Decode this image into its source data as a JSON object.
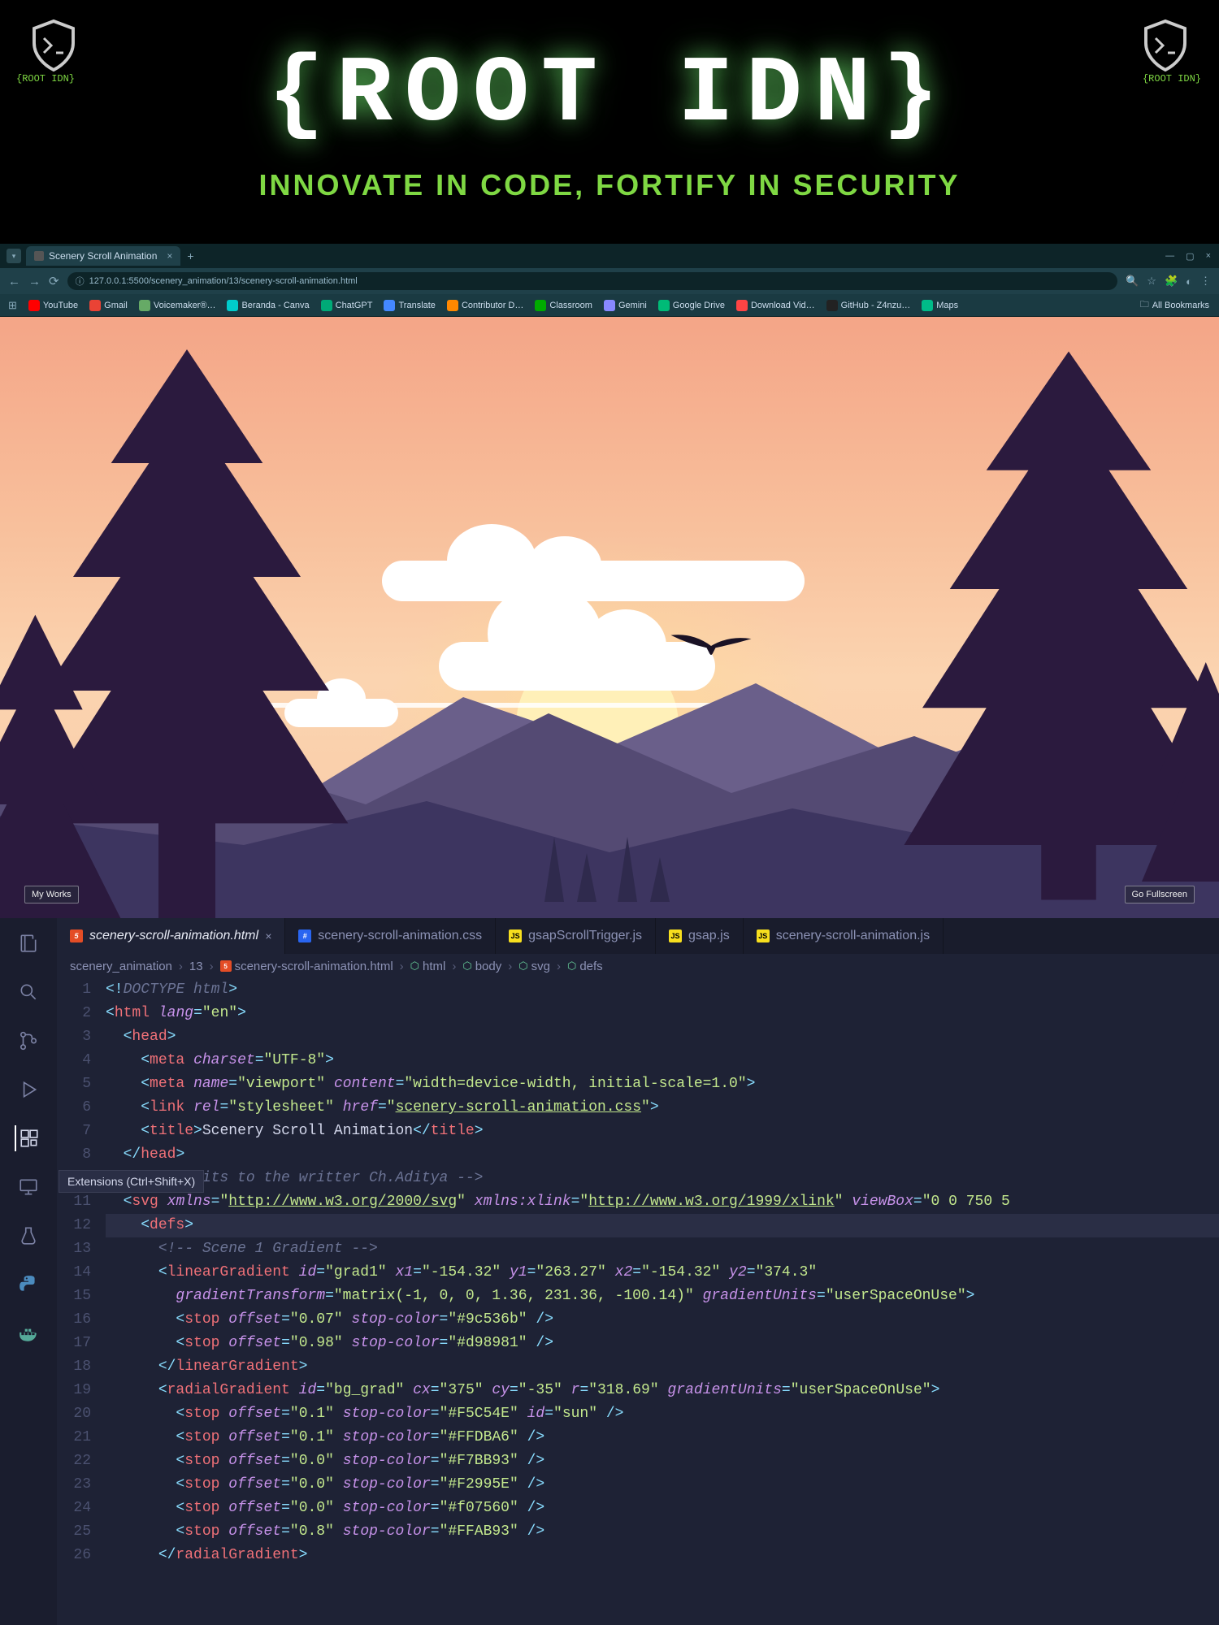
{
  "banner": {
    "title": "{ROOT IDN}",
    "subtitle": "INNOVATE IN CODE, FORTIFY IN SECURITY",
    "logo_label": "{ROOT IDN}"
  },
  "browser": {
    "tab_title": "Scenery Scroll Animation",
    "url": "127.0.0.1:5500/scenery_animation/13/scenery-scroll-animation.html",
    "bookmarks": [
      "YouTube",
      "Gmail",
      "Voicemaker®…",
      "Beranda - Canva",
      "ChatGPT",
      "Translate",
      "Contributor D…",
      "Classroom",
      "Gemini",
      "Google Drive",
      "Download Vid…",
      "GitHub - Z4nzu…",
      "Maps"
    ],
    "all_bookmarks": "All Bookmarks"
  },
  "scenery": {
    "btn_left": "My Works",
    "btn_right": "Go Fullscreen"
  },
  "editor": {
    "tooltip": "Extensions (Ctrl+Shift+X)",
    "tabs": [
      {
        "name": "scenery-scroll-animation.html",
        "type": "html",
        "active": true
      },
      {
        "name": "scenery-scroll-animation.css",
        "type": "css",
        "active": false
      },
      {
        "name": "gsapScrollTrigger.js",
        "type": "js",
        "active": false
      },
      {
        "name": "gsap.js",
        "type": "js",
        "active": false
      },
      {
        "name": "scenery-scroll-animation.js",
        "type": "js",
        "active": false
      }
    ],
    "breadcrumb": [
      "scenery_animation",
      "13",
      "scenery-scroll-animation.html",
      "html",
      "body",
      "svg",
      "defs"
    ],
    "lines": [
      {
        "n": 1,
        "html": "<span class='c-bracket'>&lt;!</span><span class='c-doctype'>DOCTYPE html</span><span class='c-bracket'>&gt;</span>"
      },
      {
        "n": 2,
        "html": "<span class='c-bracket'>&lt;</span><span class='c-tag'>html</span> <span class='c-attr'>lang</span><span class='c-bracket'>=</span><span class='c-string'>\"en\"</span><span class='c-bracket'>&gt;</span>"
      },
      {
        "n": 3,
        "html": "  <span class='c-bracket'>&lt;</span><span class='c-tag'>head</span><span class='c-bracket'>&gt;</span>"
      },
      {
        "n": 4,
        "html": "    <span class='c-bracket'>&lt;</span><span class='c-tag'>meta</span> <span class='c-attr'>charset</span><span class='c-bracket'>=</span><span class='c-string'>\"UTF-8\"</span><span class='c-bracket'>&gt;</span>"
      },
      {
        "n": 5,
        "html": "    <span class='c-bracket'>&lt;</span><span class='c-tag'>meta</span> <span class='c-attr'>name</span><span class='c-bracket'>=</span><span class='c-string'>\"viewport\"</span> <span class='c-attr'>content</span><span class='c-bracket'>=</span><span class='c-string'>\"width=device-width, initial-scale=1.0\"</span><span class='c-bracket'>&gt;</span>"
      },
      {
        "n": 6,
        "html": "    <span class='c-bracket'>&lt;</span><span class='c-tag'>link</span> <span class='c-attr'>rel</span><span class='c-bracket'>=</span><span class='c-string'>\"stylesheet\"</span> <span class='c-attr'>href</span><span class='c-bracket'>=</span><span class='c-string'>\"</span><span class='c-link'>scenery-scroll-animation.css</span><span class='c-string'>\"</span><span class='c-bracket'>&gt;</span>"
      },
      {
        "n": 7,
        "html": "    <span class='c-bracket'>&lt;</span><span class='c-tag'>title</span><span class='c-bracket'>&gt;</span><span class='c-text'>Scenery Scroll Animation</span><span class='c-bracket'>&lt;/</span><span class='c-tag'>title</span><span class='c-bracket'>&gt;</span>"
      },
      {
        "n": 8,
        "html": "  <span class='c-bracket'>&lt;/</span><span class='c-tag'>head</span><span class='c-bracket'>&gt;</span>"
      },
      {
        "n": 10,
        "html": "  <span class='c-comment'>&lt;!-- credits to the writter Ch.Aditya --&gt;</span>"
      },
      {
        "n": 11,
        "html": "  <span class='c-bracket'>&lt;</span><span class='c-tag'>svg</span> <span class='c-attr'>xmlns</span><span class='c-bracket'>=</span><span class='c-string'>\"</span><span class='c-link'>http://www.w3.org/2000/svg</span><span class='c-string'>\"</span> <span class='c-attr'>xmlns:xlink</span><span class='c-bracket'>=</span><span class='c-string'>\"</span><span class='c-link'>http://www.w3.org/1999/xlink</span><span class='c-string'>\"</span> <span class='c-attr'>viewBox</span><span class='c-bracket'>=</span><span class='c-string'>\"0 0 750 5</span>"
      },
      {
        "n": 12,
        "html": "    <span class='c-bracket'>&lt;</span><span class='c-tag'>defs</span><span class='c-bracket'>&gt;</span>",
        "hl": true
      },
      {
        "n": 13,
        "html": "      <span class='c-comment'>&lt;!-- Scene 1 Gradient --&gt;</span>"
      },
      {
        "n": 14,
        "html": "      <span class='c-bracket'>&lt;</span><span class='c-tag'>linearGradient</span> <span class='c-attr'>id</span><span class='c-bracket'>=</span><span class='c-string'>\"grad1\"</span> <span class='c-attr'>x1</span><span class='c-bracket'>=</span><span class='c-string'>\"-154.32\"</span> <span class='c-attr'>y1</span><span class='c-bracket'>=</span><span class='c-string'>\"263.27\"</span> <span class='c-attr'>x2</span><span class='c-bracket'>=</span><span class='c-string'>\"-154.32\"</span> <span class='c-attr'>y2</span><span class='c-bracket'>=</span><span class='c-string'>\"374.3\"</span>"
      },
      {
        "n": 15,
        "html": "        <span class='c-attr'>gradientTransform</span><span class='c-bracket'>=</span><span class='c-string'>\"matrix(-1, 0, 0, 1.36, 231.36, -100.14)\"</span> <span class='c-attr'>gradientUnits</span><span class='c-bracket'>=</span><span class='c-string'>\"userSpaceOnUse\"</span><span class='c-bracket'>&gt;</span>"
      },
      {
        "n": 16,
        "html": "        <span class='c-bracket'>&lt;</span><span class='c-tag'>stop</span> <span class='c-attr'>offset</span><span class='c-bracket'>=</span><span class='c-string'>\"0.07\"</span> <span class='c-attr'>stop-color</span><span class='c-bracket'>=</span><span class='c-string'>\"#9c536b\"</span> <span class='c-bracket'>/&gt;</span>"
      },
      {
        "n": 17,
        "html": "        <span class='c-bracket'>&lt;</span><span class='c-tag'>stop</span> <span class='c-attr'>offset</span><span class='c-bracket'>=</span><span class='c-string'>\"0.98\"</span> <span class='c-attr'>stop-color</span><span class='c-bracket'>=</span><span class='c-string'>\"#d98981\"</span> <span class='c-bracket'>/&gt;</span>"
      },
      {
        "n": 18,
        "html": "      <span class='c-bracket'>&lt;/</span><span class='c-tag'>linearGradient</span><span class='c-bracket'>&gt;</span>"
      },
      {
        "n": 19,
        "html": "      <span class='c-bracket'>&lt;</span><span class='c-tag'>radialGradient</span> <span class='c-attr'>id</span><span class='c-bracket'>=</span><span class='c-string'>\"bg_grad\"</span> <span class='c-attr'>cx</span><span class='c-bracket'>=</span><span class='c-string'>\"375\"</span> <span class='c-attr'>cy</span><span class='c-bracket'>=</span><span class='c-string'>\"-35\"</span> <span class='c-attr'>r</span><span class='c-bracket'>=</span><span class='c-string'>\"318.69\"</span> <span class='c-attr'>gradientUnits</span><span class='c-bracket'>=</span><span class='c-string'>\"userSpaceOnUse\"</span><span class='c-bracket'>&gt;</span>"
      },
      {
        "n": 20,
        "html": "        <span class='c-bracket'>&lt;</span><span class='c-tag'>stop</span> <span class='c-attr'>offset</span><span class='c-bracket'>=</span><span class='c-string'>\"0.1\"</span> <span class='c-attr'>stop-color</span><span class='c-bracket'>=</span><span class='c-string'>\"#F5C54E\"</span> <span class='c-attr'>id</span><span class='c-bracket'>=</span><span class='c-string'>\"sun\"</span> <span class='c-bracket'>/&gt;</span>"
      },
      {
        "n": 21,
        "html": "        <span class='c-bracket'>&lt;</span><span class='c-tag'>stop</span> <span class='c-attr'>offset</span><span class='c-bracket'>=</span><span class='c-string'>\"0.1\"</span> <span class='c-attr'>stop-color</span><span class='c-bracket'>=</span><span class='c-string'>\"#FFDBA6\"</span> <span class='c-bracket'>/&gt;</span>"
      },
      {
        "n": 22,
        "html": "        <span class='c-bracket'>&lt;</span><span class='c-tag'>stop</span> <span class='c-attr'>offset</span><span class='c-bracket'>=</span><span class='c-string'>\"0.0\"</span> <span class='c-attr'>stop-color</span><span class='c-bracket'>=</span><span class='c-string'>\"#F7BB93\"</span> <span class='c-bracket'>/&gt;</span>"
      },
      {
        "n": 23,
        "html": "        <span class='c-bracket'>&lt;</span><span class='c-tag'>stop</span> <span class='c-attr'>offset</span><span class='c-bracket'>=</span><span class='c-string'>\"0.0\"</span> <span class='c-attr'>stop-color</span><span class='c-bracket'>=</span><span class='c-string'>\"#F2995E\"</span> <span class='c-bracket'>/&gt;</span>"
      },
      {
        "n": 24,
        "html": "        <span class='c-bracket'>&lt;</span><span class='c-tag'>stop</span> <span class='c-attr'>offset</span><span class='c-bracket'>=</span><span class='c-string'>\"0.0\"</span> <span class='c-attr'>stop-color</span><span class='c-bracket'>=</span><span class='c-string'>\"#f07560\"</span> <span class='c-bracket'>/&gt;</span>"
      },
      {
        "n": 25,
        "html": "        <span class='c-bracket'>&lt;</span><span class='c-tag'>stop</span> <span class='c-attr'>offset</span><span class='c-bracket'>=</span><span class='c-string'>\"0.8\"</span> <span class='c-attr'>stop-color</span><span class='c-bracket'>=</span><span class='c-string'>\"#FFAB93\"</span> <span class='c-bracket'>/&gt;</span>"
      },
      {
        "n": 26,
        "html": "      <span class='c-bracket'>&lt;/</span><span class='c-tag'>radialGradient</span><span class='c-bracket'>&gt;</span>"
      }
    ]
  }
}
